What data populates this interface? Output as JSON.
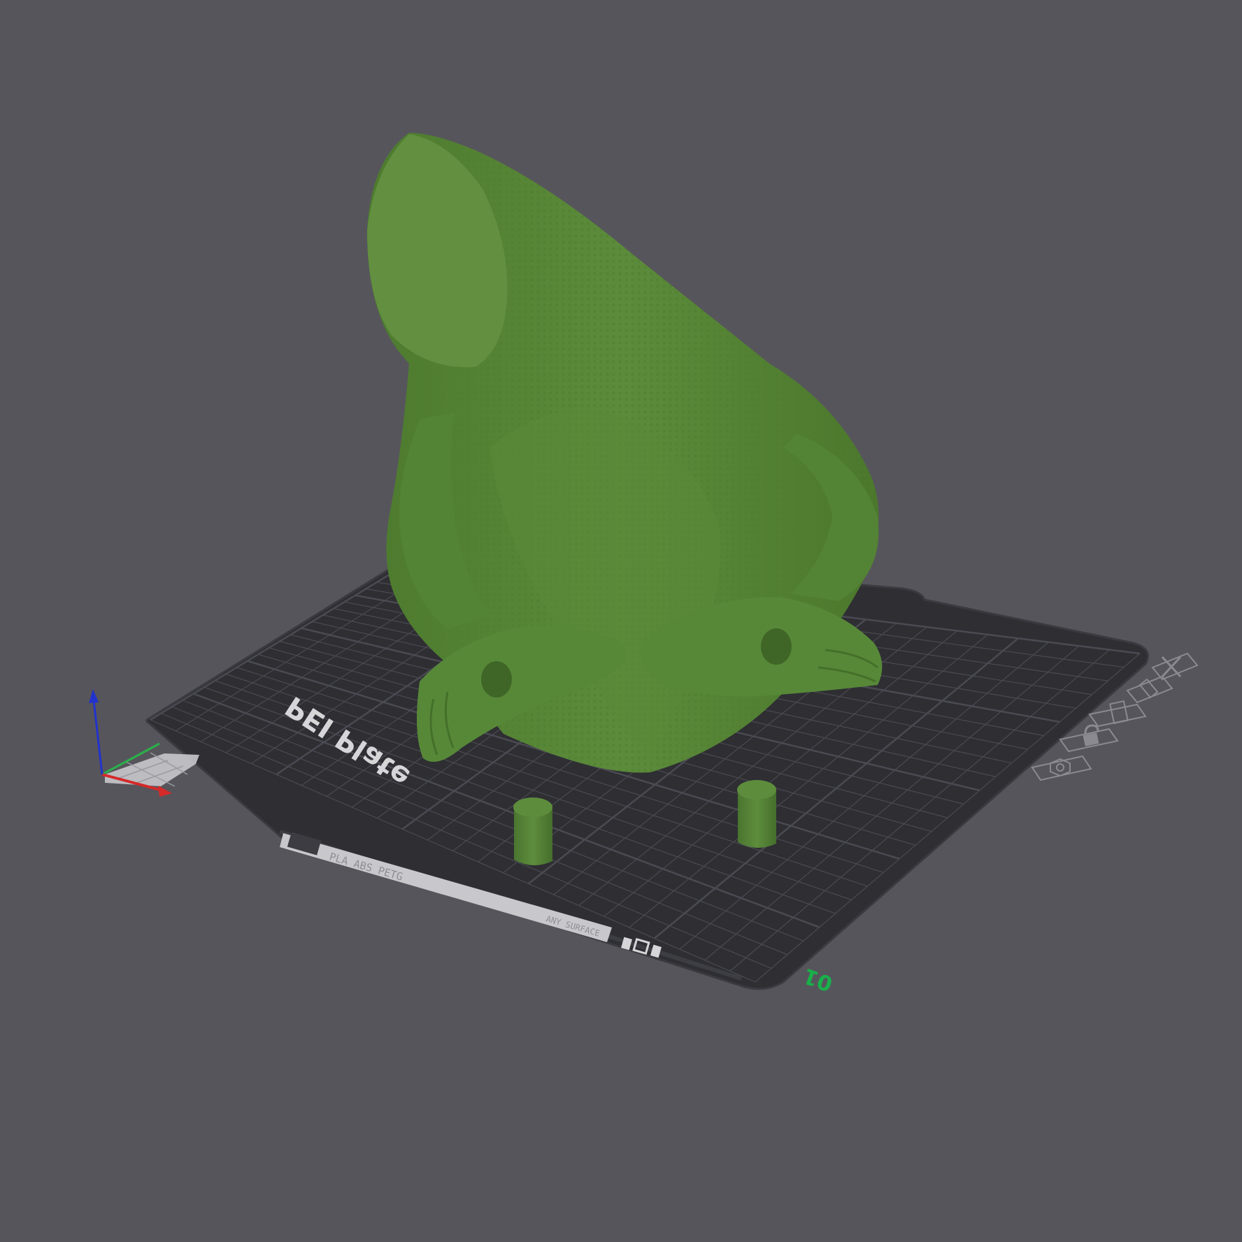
{
  "viewport": {
    "background_color": "#56555b",
    "model_color": "#5a8a3a",
    "model_cut_face_color": "#628f40",
    "bed_color": "#2e2e33",
    "grid_color": "#4a4a52"
  },
  "build_plate": {
    "label": "PEI Plate",
    "filament_strip_text": "PLA ABS PETG",
    "surface_text": "ANY SURFACE",
    "plate_number": "01",
    "plate_number_color": "#18b04a"
  },
  "axes": {
    "x_color": "#d42a2a",
    "y_color": "#2bb04a",
    "z_color": "#2233cc"
  },
  "plate_toolbar": {
    "items": [
      {
        "name": "close-plate-icon"
      },
      {
        "name": "edit-plate-icon"
      },
      {
        "name": "arrange-plate-icon"
      },
      {
        "name": "lock-plate-icon"
      },
      {
        "name": "plate-settings-icon"
      }
    ]
  }
}
